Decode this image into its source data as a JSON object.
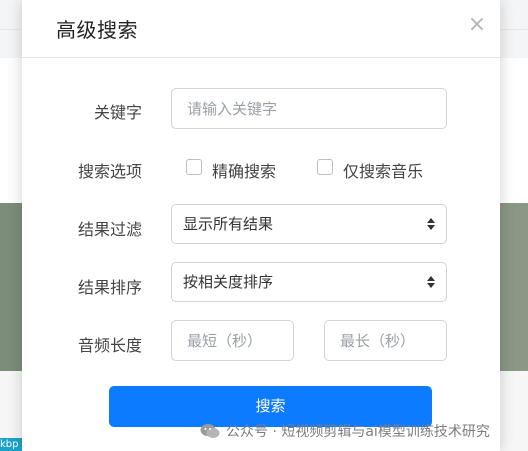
{
  "background": {
    "chip_text": "kbp"
  },
  "modal": {
    "title": "高级搜索",
    "close_glyph": "×"
  },
  "keyword": {
    "label": "关键字",
    "placeholder": "请输入关键字",
    "value": ""
  },
  "options": {
    "label": "搜索选项",
    "exact_label": "精确搜索",
    "exact_checked": false,
    "music_only_label": "仅搜索音乐",
    "music_only_checked": false
  },
  "filter": {
    "label": "结果过滤",
    "selected": "显示所有结果"
  },
  "sort": {
    "label": "结果排序",
    "selected": "按相关度排序"
  },
  "duration": {
    "label": "音频长度",
    "min_placeholder": "最短（秒）",
    "max_placeholder": "最长（秒）"
  },
  "actions": {
    "search_label": "搜索"
  },
  "watermark": {
    "text": "公众号 · 短视频剪辑与ai模型训练技术研究",
    "icon": "wechat-icon"
  },
  "colors": {
    "primary": "#0d7bff",
    "border": "#cfd4da",
    "band": "#7f8f7d"
  }
}
